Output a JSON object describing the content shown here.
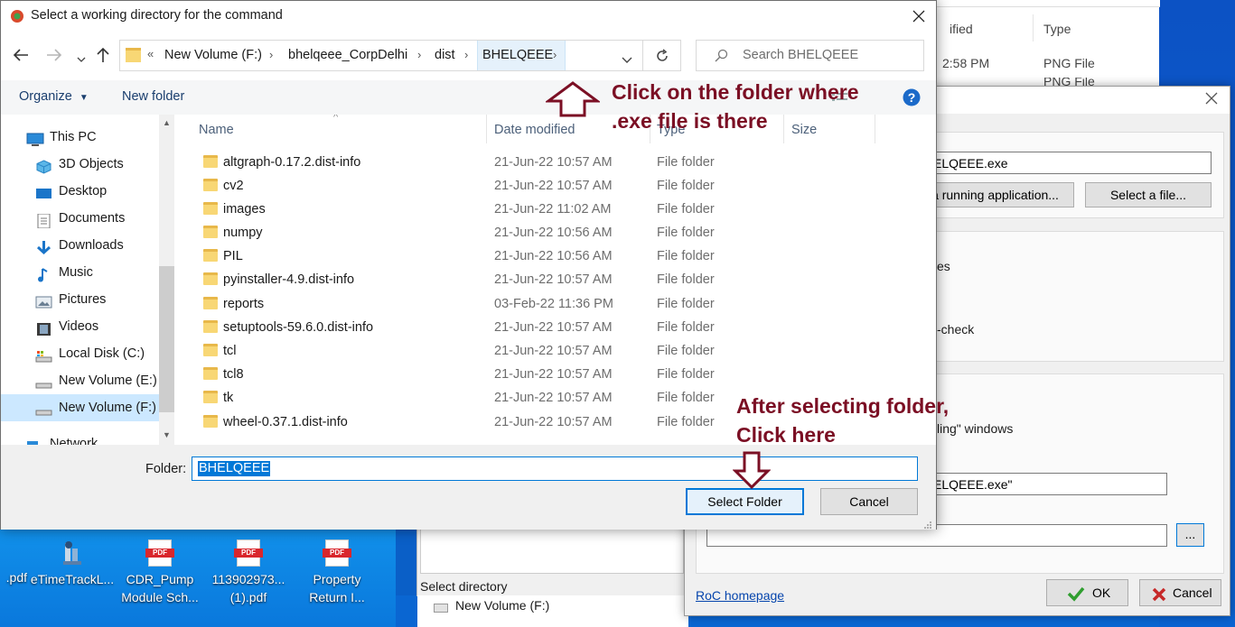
{
  "dialog": {
    "title": "Select a working directory for the command",
    "breadcrumb": [
      "New Volume (F:)",
      "bhelqeee_CorpDelhi",
      "dist",
      "BHELQEEE"
    ],
    "search_placeholder": "Search BHELQEEE",
    "toolbar": {
      "organize": "Organize",
      "new_folder": "New folder"
    },
    "columns": {
      "name": "Name",
      "date_modified": "Date modified",
      "type": "Type",
      "size": "Size"
    },
    "files": [
      {
        "name": "altgraph-0.17.2.dist-info",
        "date": "21-Jun-22 10:57 AM",
        "type": "File folder"
      },
      {
        "name": "cv2",
        "date": "21-Jun-22 10:57 AM",
        "type": "File folder"
      },
      {
        "name": "images",
        "date": "21-Jun-22 11:02 AM",
        "type": "File folder"
      },
      {
        "name": "numpy",
        "date": "21-Jun-22 10:56 AM",
        "type": "File folder"
      },
      {
        "name": "PIL",
        "date": "21-Jun-22 10:56 AM",
        "type": "File folder"
      },
      {
        "name": "pyinstaller-4.9.dist-info",
        "date": "21-Jun-22 10:57 AM",
        "type": "File folder"
      },
      {
        "name": "reports",
        "date": "03-Feb-22 11:36 PM",
        "type": "File folder"
      },
      {
        "name": "setuptools-59.6.0.dist-info",
        "date": "21-Jun-22 10:57 AM",
        "type": "File folder"
      },
      {
        "name": "tcl",
        "date": "21-Jun-22 10:57 AM",
        "type": "File folder"
      },
      {
        "name": "tcl8",
        "date": "21-Jun-22 10:57 AM",
        "type": "File folder"
      },
      {
        "name": "tk",
        "date": "21-Jun-22 10:57 AM",
        "type": "File folder"
      },
      {
        "name": "wheel-0.37.1.dist-info",
        "date": "21-Jun-22 10:57 AM",
        "type": "File folder"
      }
    ],
    "folder_label": "Folder:",
    "folder_value": "BHELQEEE",
    "select_button": "Select Folder",
    "cancel_button": "Cancel"
  },
  "nav": {
    "items": [
      {
        "label": "This PC",
        "icon": "pc-icon"
      },
      {
        "label": "3D Objects",
        "icon": "cube-icon"
      },
      {
        "label": "Desktop",
        "icon": "desktop-icon"
      },
      {
        "label": "Documents",
        "icon": "documents-icon"
      },
      {
        "label": "Downloads",
        "icon": "download-icon"
      },
      {
        "label": "Music",
        "icon": "music-icon"
      },
      {
        "label": "Pictures",
        "icon": "pictures-icon"
      },
      {
        "label": "Videos",
        "icon": "videos-icon"
      },
      {
        "label": "Local Disk (C:)",
        "icon": "drive-icon"
      },
      {
        "label": "New Volume (E:)",
        "icon": "drive-icon"
      },
      {
        "label": "New Volume (F:)",
        "icon": "drive-icon",
        "selected": true
      },
      {
        "label": "Network",
        "icon": "network-icon"
      }
    ]
  },
  "annotations": {
    "top_line1": "Click on the folder where",
    "top_line2": ".exe file is there",
    "bottom_line1": "After selecting folder,",
    "bottom_line2": "Click here",
    "color": "#7b0f24"
  },
  "roc": {
    "exe_field": "ELQEEE.exe",
    "running_app_button": "a running application...",
    "select_file_button": "Select a file...",
    "text_es": "es",
    "text_check": "-check",
    "text_windows": "ling\" windows",
    "cmd_field": "ELQEEE.exe\"",
    "dir_field": "",
    "browse_button": "...",
    "homepage_link": "RoC homepage",
    "ok_button": "OK",
    "cancel_button": "Cancel"
  },
  "bg_explorer": {
    "col_modified": "ified",
    "col_type": "Type",
    "row1_time": "2:58 PM",
    "row1_type": "PNG File",
    "row2_type": "PNG File"
  },
  "bg_mid": {
    "label": "Select directory",
    "drive": "New Volume (F:)"
  },
  "desktop_icons": [
    {
      "label1": ".pdf",
      "label2": ""
    },
    {
      "label1": "eTimeTrackL...",
      "label2": ""
    },
    {
      "label1": "CDR_Pump",
      "label2": "Module Sch..."
    },
    {
      "label1": "113902973...",
      "label2": "(1).pdf"
    },
    {
      "label1": "Property",
      "label2": "Return I..."
    }
  ]
}
